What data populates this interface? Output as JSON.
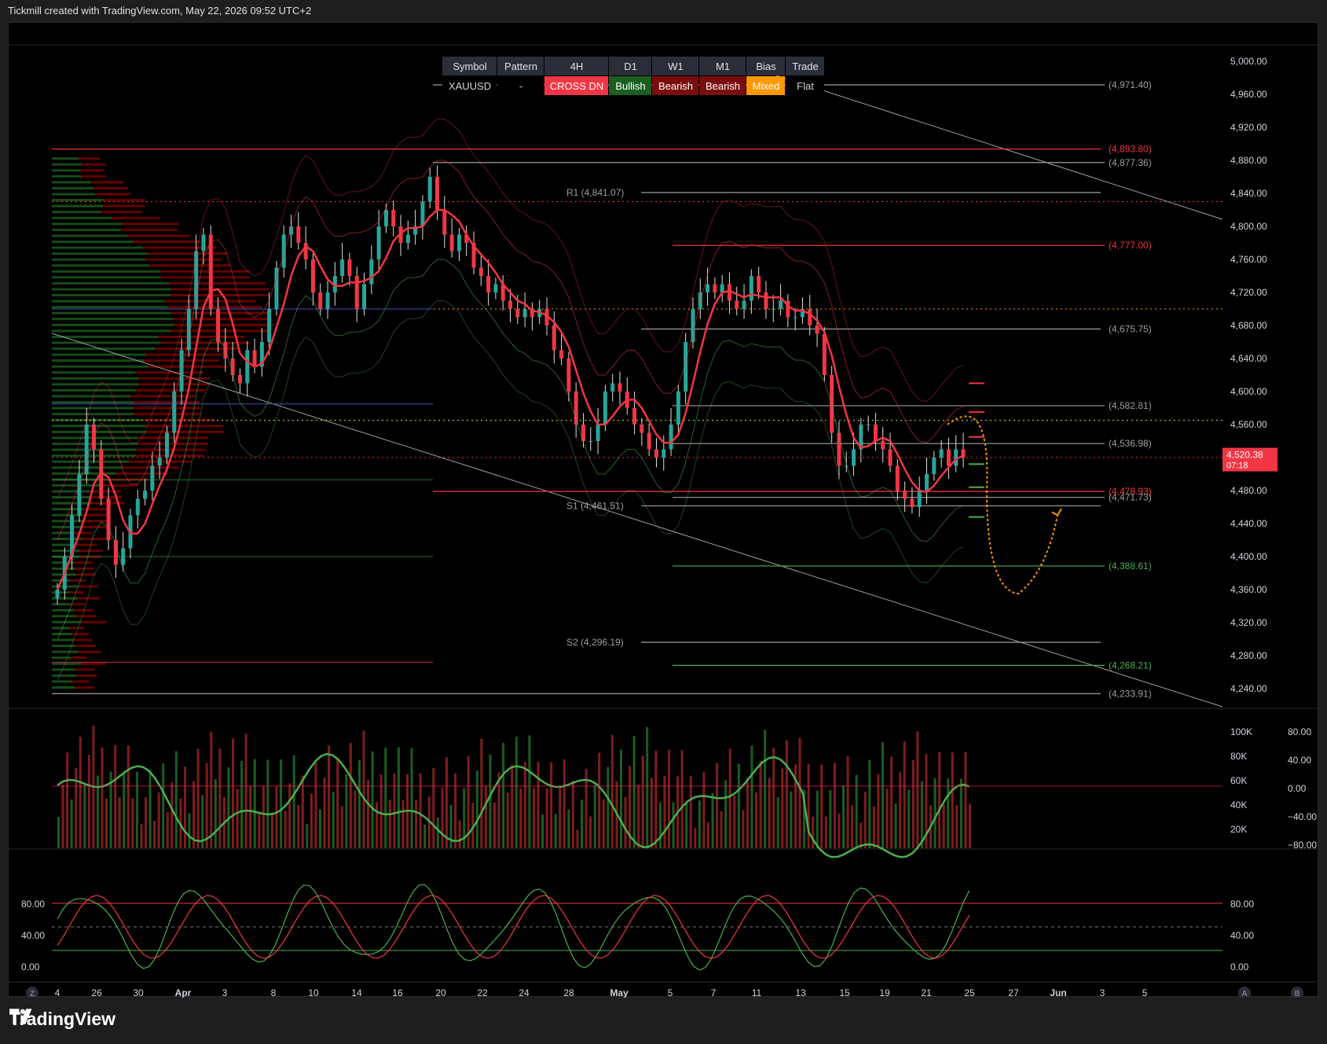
{
  "header": {
    "caption": "Tickmill created with TradingView.com, May 22, 2026 09:52 UTC+2"
  },
  "footer": {
    "brand": "TradingView"
  },
  "summary_table": {
    "headers": [
      "Symbol",
      "Pattern",
      "4H",
      "D1",
      "W1",
      "M1",
      "Bias",
      "Trade"
    ],
    "row": [
      {
        "text": "XAUUSD",
        "bg": "#000000",
        "color": "#d1d4dc"
      },
      {
        "text": "-",
        "bg": "#000000",
        "color": "#d1d4dc"
      },
      {
        "text": "CROSS DN",
        "bg": "#f23645",
        "color": "#ffffff"
      },
      {
        "text": "Bullish",
        "bg": "#1b5e20",
        "color": "#ffffff"
      },
      {
        "text": "Bearish",
        "bg": "#7a0d0d",
        "color": "#ffffff"
      },
      {
        "text": "Bearish",
        "bg": "#7a0d0d",
        "color": "#ffffff"
      },
      {
        "text": "Mixed",
        "bg": "#ff9800",
        "color": "#ffffff"
      },
      {
        "text": "Flat",
        "bg": "#000000",
        "color": "#d1d4dc"
      }
    ]
  },
  "colors": {
    "up": "#26a69a",
    "down": "#f23645",
    "green_line": "#4caf50",
    "red_line": "#f23645",
    "orange": "#ff9800",
    "bg": "#000000"
  },
  "chart_data": [
    {
      "type": "candlestick",
      "symbol": "XAUUSD",
      "ylim": [
        4220,
        5020
      ],
      "price_ticks": [
        "5,000.00",
        "4,960.00",
        "4,920.00",
        "4,880.00",
        "4,840.00",
        "4,800.00",
        "4,760.00",
        "4,720.00",
        "4,680.00",
        "4,640.00",
        "4,600.00",
        "4,560.00",
        "4,520.00",
        "4,480.00",
        "4,440.00",
        "4,400.00",
        "4,360.00",
        "4,320.00",
        "4,280.00",
        "4,240.00"
      ],
      "x_ticks": [
        "4",
        "26",
        "30",
        "Apr",
        "3",
        "8",
        "10",
        "14",
        "16",
        "20",
        "22",
        "24",
        "28",
        "May",
        "5",
        "7",
        "11",
        "13",
        "15",
        "19",
        "21",
        "25",
        "27",
        "Jun",
        "3",
        "5"
      ],
      "current_price": {
        "label": "4,520.38",
        "countdown": "07:18",
        "value": 4520.38
      },
      "levels": [
        {
          "label": "(4,971.40)",
          "value": 4971.4,
          "color": "#9e9e9e"
        },
        {
          "label": "(4,893.80)",
          "value": 4893.8,
          "color": "#f23645"
        },
        {
          "label": "(4,877.36)",
          "value": 4877.36,
          "color": "#9e9e9e"
        },
        {
          "label": "R1 (4,841.07)",
          "value": 4841.07,
          "color": "#9e9e9e"
        },
        {
          "label": "(4,777.00)",
          "value": 4777.0,
          "color": "#f23645"
        },
        {
          "label": "(4,675.75)",
          "value": 4675.75,
          "color": "#9e9e9e"
        },
        {
          "label": "(4,582.81)",
          "value": 4582.81,
          "color": "#9e9e9e"
        },
        {
          "label": "(4,536.98)",
          "value": 4536.98,
          "color": "#9e9e9e"
        },
        {
          "label": "(4,478.93)",
          "value": 4478.93,
          "color": "#f23645"
        },
        {
          "label": "(4,471.73)",
          "value": 4471.73,
          "color": "#9e9e9e"
        },
        {
          "label": "S1 (4,461.51)",
          "value": 4461.51,
          "color": "#9e9e9e"
        },
        {
          "label": "(4,388.61)",
          "value": 4388.61,
          "color": "#4caf50"
        },
        {
          "label": "S2 (4,296.19)",
          "value": 4296.19,
          "color": "#9e9e9e"
        },
        {
          "label": "(4,268.21)",
          "value": 4268.21,
          "color": "#4caf50"
        },
        {
          "label": "(4,233.91)",
          "value": 4233.91,
          "color": "#9e9e9e"
        }
      ],
      "close_series": [
        4360,
        4400,
        4450,
        4500,
        4560,
        4530,
        4470,
        4420,
        4390,
        4410,
        4450,
        4470,
        4480,
        4510,
        4520,
        4550,
        4600,
        4650,
        4700,
        4770,
        4790,
        4700,
        4660,
        4640,
        4620,
        4610,
        4650,
        4630,
        4660,
        4700,
        4750,
        4790,
        4800,
        4780,
        4760,
        4720,
        4700,
        4720,
        4740,
        4760,
        4740,
        4700,
        4730,
        4760,
        4800,
        4820,
        4800,
        4780,
        4790,
        4800,
        4830,
        4860,
        4820,
        4790,
        4770,
        4790,
        4780,
        4750,
        4740,
        4720,
        4730,
        4710,
        4700,
        4690,
        4700,
        4690,
        4700,
        4680,
        4650,
        4640,
        4600,
        4560,
        4540,
        4540,
        4560,
        4600,
        4610,
        4600,
        4580,
        4560,
        4550,
        4530,
        4520,
        4530,
        4560,
        4600,
        4660,
        4700,
        4720,
        4730,
        4720,
        4730,
        4710,
        4700,
        4710,
        4740,
        4720,
        4700,
        4700,
        4710,
        4690,
        4690,
        4700,
        4680,
        4670,
        4620,
        4550,
        4510,
        4510,
        4530,
        4560,
        4560,
        4540,
        4530,
        4510,
        4480,
        4470,
        4460,
        4480,
        4500,
        4520,
        4530,
        4510,
        4530,
        4520
      ]
    },
    {
      "type": "bar",
      "name": "volume",
      "ylim": [
        0,
        100000
      ],
      "ticks": [
        "100K",
        "80K",
        "60K",
        "40K",
        "20K"
      ],
      "oscillator_ticks": [
        "80.00",
        "40.00",
        "0.00",
        "−40.00",
        "−80.00"
      ]
    },
    {
      "type": "line",
      "name": "stochastic",
      "ylim": [
        0,
        100
      ],
      "left_ticks": [
        "80.00",
        "40.00",
        "0.00"
      ],
      "right_ticks": [
        "80.00",
        "40.00",
        "0.00"
      ],
      "bands": [
        80,
        20
      ]
    }
  ],
  "bottom_icons": {
    "left": "Z",
    "right_a": "A",
    "right_b": "B"
  }
}
